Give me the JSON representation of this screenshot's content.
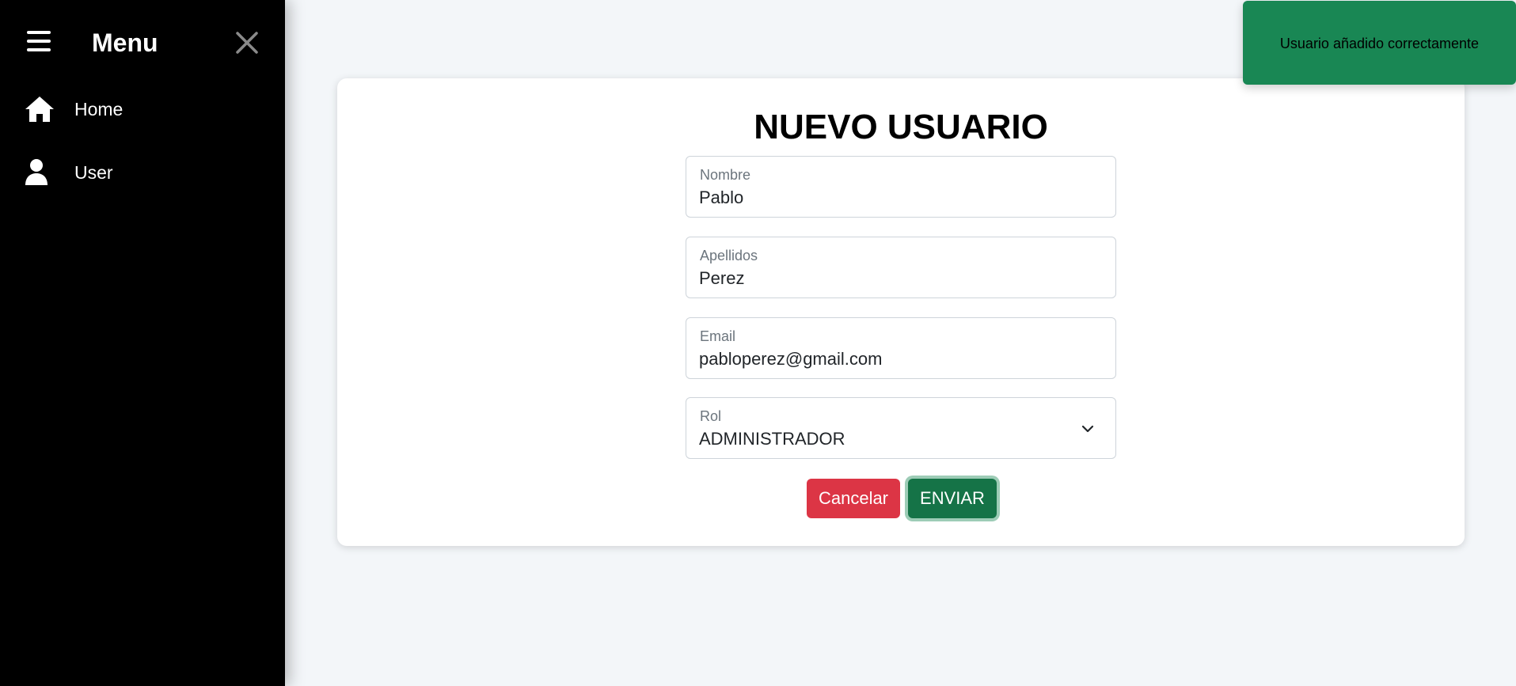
{
  "sidebar": {
    "title": "Menu",
    "items": [
      {
        "label": "Home",
        "icon": "home-icon"
      },
      {
        "label": "User",
        "icon": "user-icon"
      }
    ]
  },
  "form": {
    "title": "NUEVO USUARIO",
    "fields": [
      {
        "label": "Nombre",
        "value": "Pablo"
      },
      {
        "label": "Apellidos",
        "value": "Perez"
      },
      {
        "label": "Email",
        "value": "pabloperez@gmail.com"
      },
      {
        "label": "Rol",
        "value": "ADMINISTRADOR"
      }
    ],
    "cancel_label": "Cancelar",
    "submit_label": "ENVIAR"
  },
  "toast": {
    "message": "Usuario añadido correctamente"
  },
  "colors": {
    "sidebar_bg": "#000000",
    "page_bg": "#f3f6f9",
    "cancel": "#dc3545",
    "submit": "#157347",
    "toast": "#198754"
  }
}
